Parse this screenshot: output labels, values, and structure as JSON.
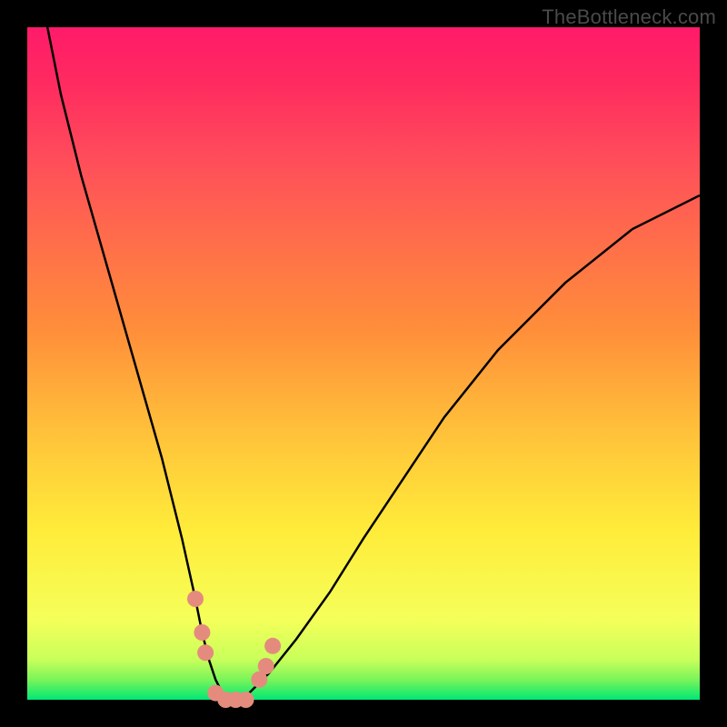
{
  "watermark": "TheBottleneck.com",
  "colors": {
    "gradient_top": "#ff1a6a",
    "gradient_mid": "#ffee3a",
    "gradient_bottom": "#00e874",
    "curve": "#000000",
    "marker": "#e48b7e",
    "frame": "#000000"
  },
  "chart_data": {
    "type": "line",
    "title": "",
    "xlabel": "",
    "ylabel": "",
    "xlim": [
      0,
      100
    ],
    "ylim": [
      0,
      100
    ],
    "grid": false,
    "series": [
      {
        "name": "bottleneck-curve",
        "x": [
          3,
          5,
          8,
          12,
          16,
          20,
          23,
          25,
          26,
          27,
          28,
          29,
          30,
          31,
          32,
          33,
          34,
          36,
          40,
          45,
          50,
          56,
          62,
          70,
          80,
          90,
          100
        ],
        "values": [
          100,
          90,
          78,
          64,
          50,
          36,
          24,
          15,
          10,
          6,
          3,
          1,
          0,
          0,
          0,
          1,
          2,
          4,
          9,
          16,
          24,
          33,
          42,
          52,
          62,
          70,
          75
        ]
      }
    ],
    "markers": [
      {
        "x": 25.0,
        "y": 15
      },
      {
        "x": 26.0,
        "y": 10
      },
      {
        "x": 26.5,
        "y": 7
      },
      {
        "x": 28.0,
        "y": 1
      },
      {
        "x": 29.5,
        "y": 0
      },
      {
        "x": 31.0,
        "y": 0
      },
      {
        "x": 32.5,
        "y": 0
      },
      {
        "x": 34.5,
        "y": 3
      },
      {
        "x": 35.5,
        "y": 5
      },
      {
        "x": 36.5,
        "y": 8
      }
    ]
  }
}
